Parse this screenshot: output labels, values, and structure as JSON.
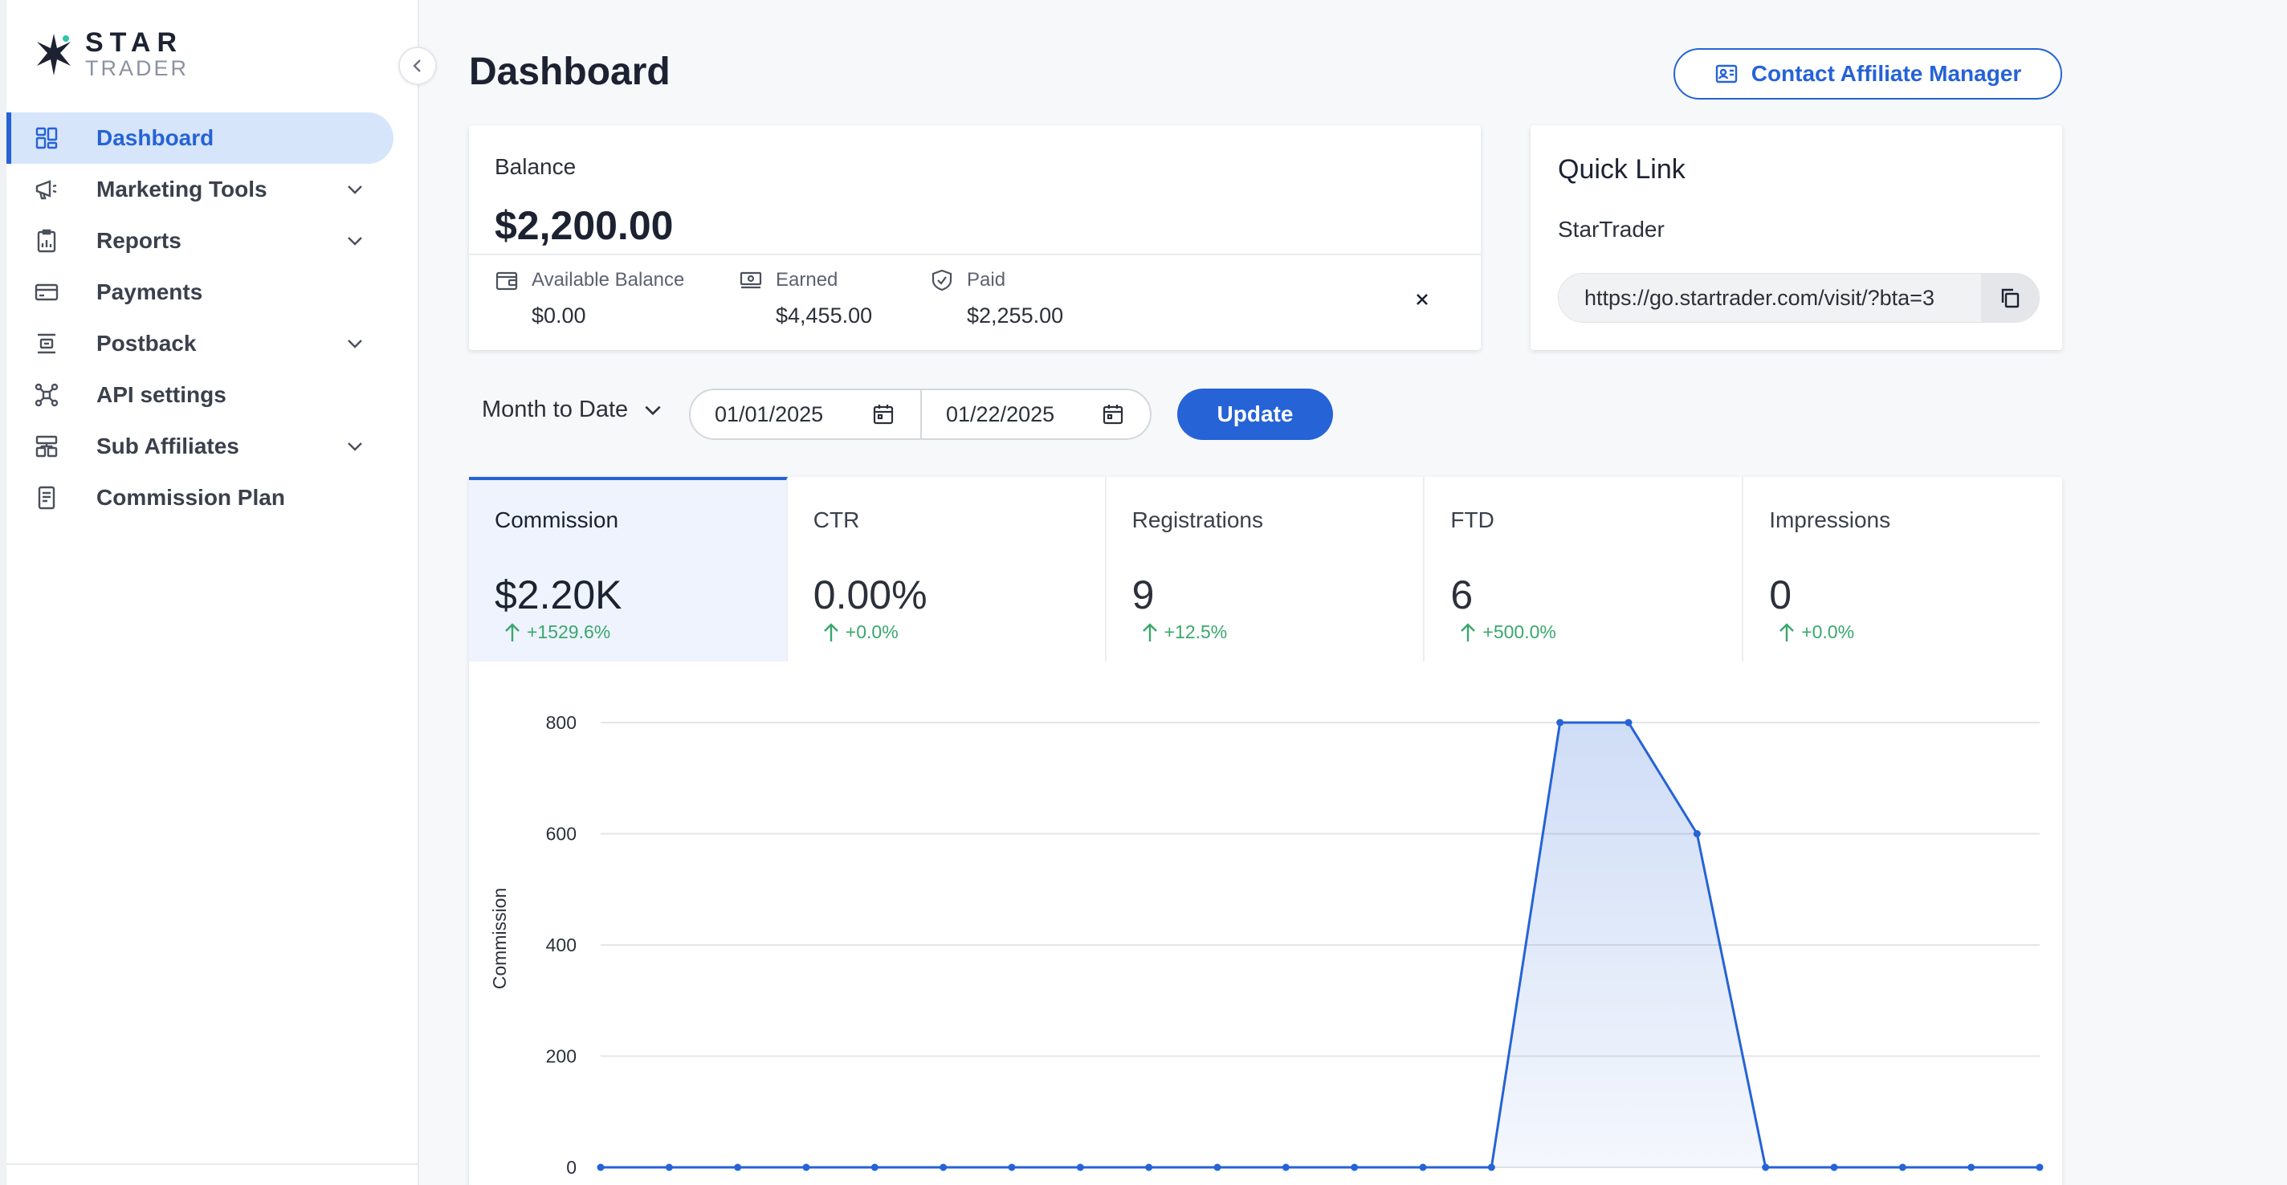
{
  "brand": {
    "name_top": "STAR",
    "name_bottom": "TRADER"
  },
  "sidebar": {
    "items": [
      {
        "label": "Dashboard",
        "icon": "dashboard-icon",
        "active": true,
        "expandable": false
      },
      {
        "label": "Marketing Tools",
        "icon": "megaphone-icon",
        "active": false,
        "expandable": true
      },
      {
        "label": "Reports",
        "icon": "report-icon",
        "active": false,
        "expandable": true
      },
      {
        "label": "Payments",
        "icon": "card-icon",
        "active": false,
        "expandable": false
      },
      {
        "label": "Postback",
        "icon": "postback-icon",
        "active": false,
        "expandable": true
      },
      {
        "label": "API settings",
        "icon": "api-icon",
        "active": false,
        "expandable": false
      },
      {
        "label": "Sub Affiliates",
        "icon": "sub-affiliates-icon",
        "active": false,
        "expandable": true
      },
      {
        "label": "Commission Plan",
        "icon": "document-icon",
        "active": false,
        "expandable": false
      }
    ]
  },
  "header": {
    "title": "Dashboard",
    "contact_label": "Contact Affiliate Manager"
  },
  "balance": {
    "label": "Balance",
    "value": "$2,200.00",
    "available_label": "Available Balance",
    "available_value": "$0.00",
    "earned_label": "Earned",
    "earned_value": "$4,455.00",
    "paid_label": "Paid",
    "paid_value": "$2,255.00"
  },
  "quick_link": {
    "title": "Quick Link",
    "name": "StarTrader",
    "url": "https://go.startrader.com/visit/?bta=3"
  },
  "filters": {
    "range_label": "Month to Date",
    "start_date": "01/01/2025",
    "end_date": "01/22/2025",
    "update_label": "Update"
  },
  "metrics": [
    {
      "label": "Commission",
      "value": "$2.20K",
      "change": "+1529.6%",
      "active": true
    },
    {
      "label": "CTR",
      "value": "0.00%",
      "change": "+0.0%",
      "active": false
    },
    {
      "label": "Registrations",
      "value": "9",
      "change": "+12.5%",
      "active": false
    },
    {
      "label": "FTD",
      "value": "6",
      "change": "+500.0%",
      "active": false
    },
    {
      "label": "Impressions",
      "value": "0",
      "change": "+0.0%",
      "active": false
    }
  ],
  "colors": {
    "accent": "#2563d6",
    "positive": "#3aa76d",
    "active_bg": "#d7e5fb"
  },
  "chart_data": {
    "type": "area",
    "ylabel": "Commission",
    "ylim": [
      0,
      800
    ],
    "yticks": [
      0,
      200,
      400,
      600,
      800
    ],
    "values": [
      0,
      0,
      0,
      0,
      0,
      0,
      0,
      0,
      0,
      0,
      0,
      0,
      0,
      0,
      800,
      800,
      600,
      0,
      0,
      0,
      0,
      0
    ],
    "grid": true
  }
}
